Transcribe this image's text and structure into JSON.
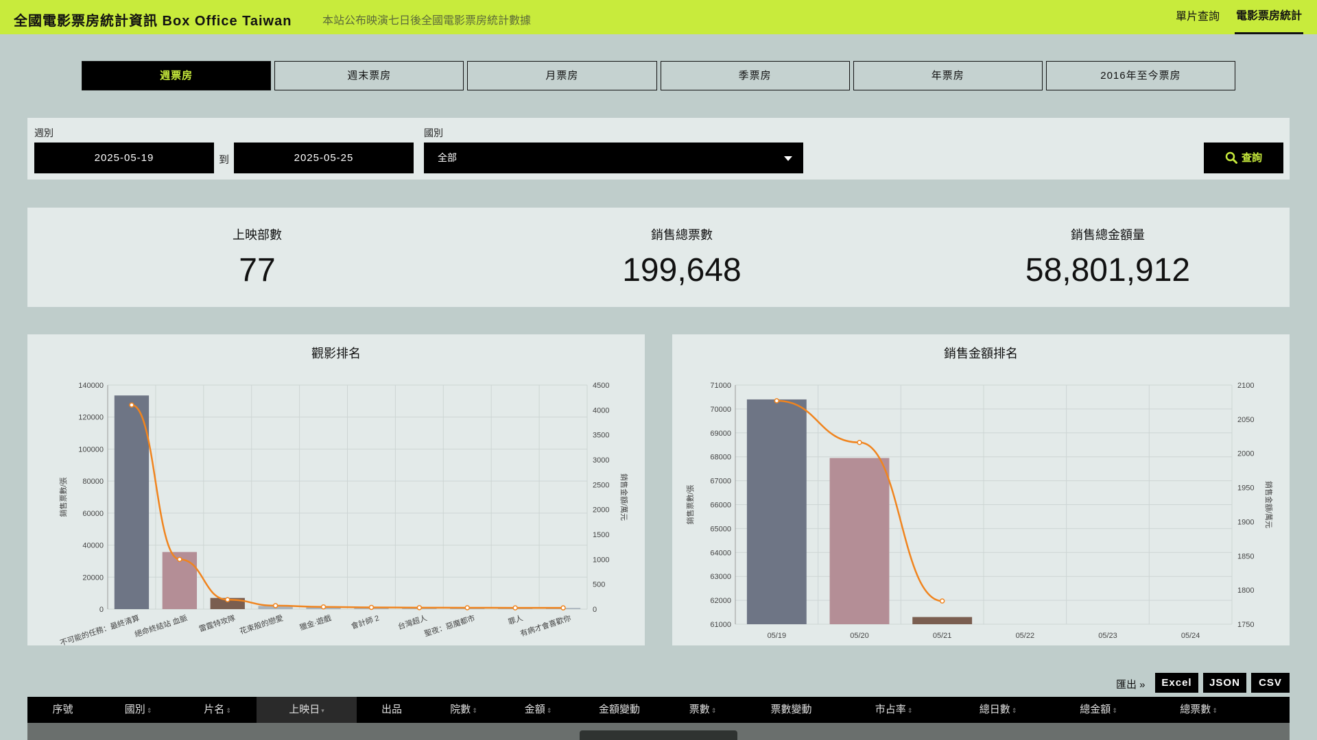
{
  "header": {
    "title": "全國電影票房統計資訊 Box Office Taiwan",
    "subtitle": "本站公布映演七日後全國電影票房統計數據",
    "nav": [
      {
        "label": "單片查詢",
        "active": false
      },
      {
        "label": "電影票房統計",
        "active": true
      }
    ]
  },
  "tabs": [
    {
      "label": "週票房",
      "active": true
    },
    {
      "label": "週末票房",
      "active": false
    },
    {
      "label": "月票房",
      "active": false
    },
    {
      "label": "季票房",
      "active": false
    },
    {
      "label": "年票房",
      "active": false
    },
    {
      "label": "2016年至今票房",
      "active": false
    }
  ],
  "filter": {
    "week_label": "週別",
    "start_date": "2025-05-19",
    "to_label": "到",
    "end_date": "2025-05-25",
    "country_label": "國別",
    "country_value": "全部",
    "search_label": "查詢"
  },
  "stats": {
    "films_label": "上映部數",
    "films_value": "77",
    "tickets_label": "銷售總票數",
    "tickets_value": "199,648",
    "amount_label": "銷售總金額量",
    "amount_value": "58,801,912"
  },
  "charts": [
    {
      "title": "觀影排名",
      "type": "bar",
      "y_left_label": "銷售票數/張",
      "y_right_label": "銷售金額/萬元",
      "y_left_ticks": [
        "0",
        "20000",
        "40000",
        "60000",
        "80000",
        "100000",
        "120000",
        "140000"
      ],
      "y_right_ticks": [
        "0",
        "500",
        "1000",
        "1500",
        "2000",
        "2500",
        "3000",
        "3500",
        "4000",
        "4500"
      ],
      "x_labels": [
        "不可能的任務：最終清算",
        "絕命終結站 血脈",
        "雷霆特攻隊",
        "花束般的戀愛",
        "獵金·遊戲",
        "會計師 2",
        "台灣超人",
        "聖夜：惡魔都市",
        "罪人",
        "有病才會喜歡你"
      ],
      "colors": {
        "bar1": "#6e7585",
        "bar2": "#b48e96",
        "bar3": "#7a5e50",
        "bar_rest": "#a9b3bc",
        "line": "#f0841e"
      }
    },
    {
      "title": "銷售金額排名",
      "type": "bar",
      "y_left_label": "銷售票數/張",
      "y_right_label": "銷售金額/萬元",
      "y_left_ticks": [
        "61000",
        "62000",
        "63000",
        "64000",
        "65000",
        "66000",
        "67000",
        "68000",
        "69000",
        "70000",
        "71000"
      ],
      "y_right_ticks": [
        "1750",
        "1800",
        "1850",
        "1900",
        "1950",
        "2000",
        "2050",
        "2100"
      ],
      "x_labels": [
        "05/19",
        "05/20",
        "05/21",
        "05/22",
        "05/23",
        "05/24"
      ],
      "colors": {
        "bar1": "#6e7585",
        "bar2": "#b48e96",
        "bar3": "#7a5e50",
        "line": "#f0841e"
      }
    }
  ],
  "chart_data": [
    {
      "type": "bar",
      "title": "觀影排名",
      "categories": [
        "不可能的任務：最終清算",
        "絕命終結站 血脈",
        "雷霆特攻隊",
        "花束般的戀愛",
        "獵金·遊戲",
        "會計師 2",
        "台灣超人",
        "聖夜：惡魔都市",
        "罪人",
        "有病才會喜歡你"
      ],
      "series": [
        {
          "name": "銷售票數/張",
          "type": "bar",
          "axis": "left",
          "values": [
            133500,
            35700,
            7000,
            2000,
            1300,
            1000,
            900,
            850,
            800,
            750
          ]
        },
        {
          "name": "銷售金額/萬元",
          "type": "line",
          "axis": "right",
          "values": [
            4100,
            1000,
            190,
            70,
            45,
            35,
            30,
            28,
            26,
            25
          ]
        }
      ],
      "ylim_left": [
        0,
        140000
      ],
      "ylim_right": [
        0,
        4500
      ]
    },
    {
      "type": "bar",
      "title": "銷售金額排名",
      "categories": [
        "05/19",
        "05/20",
        "05/21",
        "05/22",
        "05/23",
        "05/24"
      ],
      "series": [
        {
          "name": "銷售票數/張",
          "type": "bar",
          "axis": "left",
          "values": [
            70400,
            67950,
            61300
          ]
        },
        {
          "name": "銷售金額/萬元",
          "type": "line",
          "axis": "right",
          "values": [
            2077,
            2016,
            1784
          ]
        }
      ],
      "ylim_left": [
        61000,
        71000
      ],
      "ylim_right": [
        1750,
        2100
      ]
    }
  ],
  "export": {
    "label": "匯出 »",
    "buttons": [
      "Excel",
      "JSON",
      "CSV"
    ]
  },
  "table": {
    "columns": [
      {
        "label": "序號",
        "sortable": false
      },
      {
        "label": "國別",
        "sortable": true
      },
      {
        "label": "片名",
        "sortable": true
      },
      {
        "label": "上映日",
        "sortable": true,
        "sorted": true
      },
      {
        "label": "出品",
        "sortable": false
      },
      {
        "label": "院數",
        "sortable": true
      },
      {
        "label": "金額",
        "sortable": true
      },
      {
        "label": "金額變動",
        "sortable": false
      },
      {
        "label": "票數",
        "sortable": true
      },
      {
        "label": "票數變動",
        "sortable": false
      },
      {
        "label": "市占率",
        "sortable": true
      },
      {
        "label": "總日數",
        "sortable": true
      },
      {
        "label": "總金額",
        "sortable": true
      },
      {
        "label": "總票數",
        "sortable": true
      }
    ]
  }
}
